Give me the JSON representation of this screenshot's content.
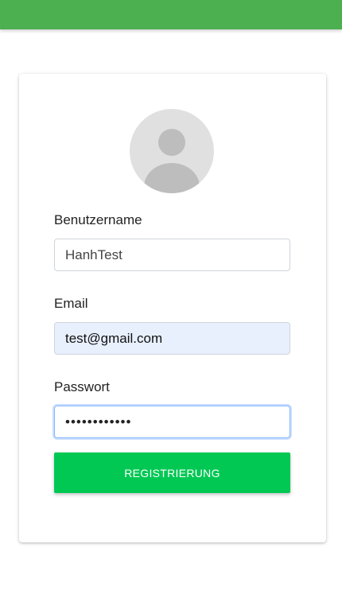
{
  "header": {
    "color": "#4caf50"
  },
  "form": {
    "avatar_icon": "user-placeholder-icon",
    "username": {
      "label": "Benutzername",
      "value": "HanhTest"
    },
    "email": {
      "label": "Email",
      "value": "test@gmail.com"
    },
    "password": {
      "label": "Passwort",
      "value": "••••••••••••"
    },
    "submit_label": "REGISTRIERUNG",
    "submit_color": "#00c853"
  }
}
